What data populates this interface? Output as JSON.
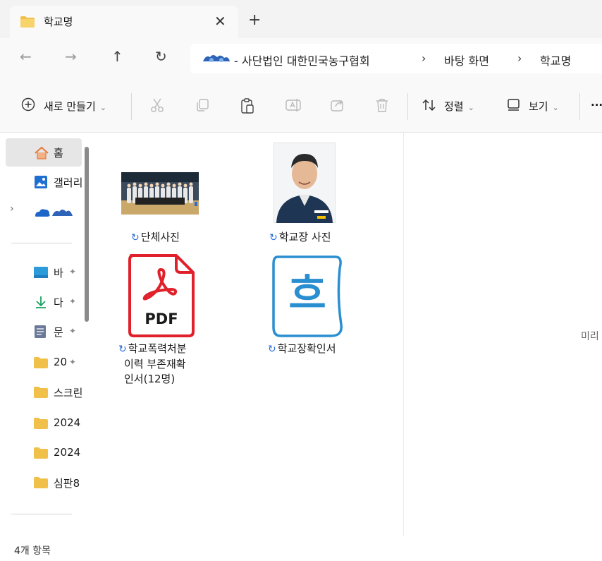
{
  "tab": {
    "title": "학교명",
    "close": "✕",
    "new_tab": "+"
  },
  "nav": {
    "back": "←",
    "forward": "→",
    "up": "↑",
    "refresh": "↻"
  },
  "address": {
    "org": "- 사단법인 대한민국농구협회",
    "sep": "›",
    "crumb1": "바탕 화면",
    "crumb2": "학교명"
  },
  "toolbar": {
    "new_label": "새로 만들기",
    "sort_label": "정렬",
    "view_label": "보기",
    "chevron": "⌄",
    "more": "···"
  },
  "sidebar": {
    "expander": "›",
    "items": [
      {
        "label": "홈",
        "icon": "home-icon"
      },
      {
        "label": "갤러리",
        "icon": "gallery-icon"
      },
      {
        "label": "",
        "icon": "onedrive-icon"
      },
      {
        "label": "바",
        "icon": "desktop-icon",
        "pinned": true
      },
      {
        "label": "다",
        "icon": "download-icon",
        "pinned": true
      },
      {
        "label": "문",
        "icon": "documents-icon",
        "pinned": true
      },
      {
        "label": "20",
        "icon": "folder-icon",
        "pinned": true
      },
      {
        "label": "스크린",
        "icon": "folder-icon"
      },
      {
        "label": "2024",
        "icon": "folder-icon"
      },
      {
        "label": "2024",
        "icon": "folder-icon"
      },
      {
        "label": "심판8",
        "icon": "folder-icon"
      }
    ],
    "pin": "✦"
  },
  "files": [
    {
      "name": "단체사진",
      "type": "image"
    },
    {
      "name": "학교장 사진",
      "type": "image"
    },
    {
      "name_lines": [
        "학교폭력처분",
        "이력 부존재확",
        "인서(12명)"
      ],
      "type": "pdf",
      "pdf_text": "PDF"
    },
    {
      "name": "학교장확인서",
      "type": "hwp",
      "hwp_glyph": "흐"
    }
  ],
  "sync_glyph": "↻",
  "preview": {
    "text": "미리"
  },
  "status": {
    "count": "4개 항목"
  },
  "colors": {
    "folder": "#f0c04a",
    "accent": "#2a6bd6",
    "pdf_red": "#e0212b",
    "hwp_blue": "#2a8fd0"
  }
}
